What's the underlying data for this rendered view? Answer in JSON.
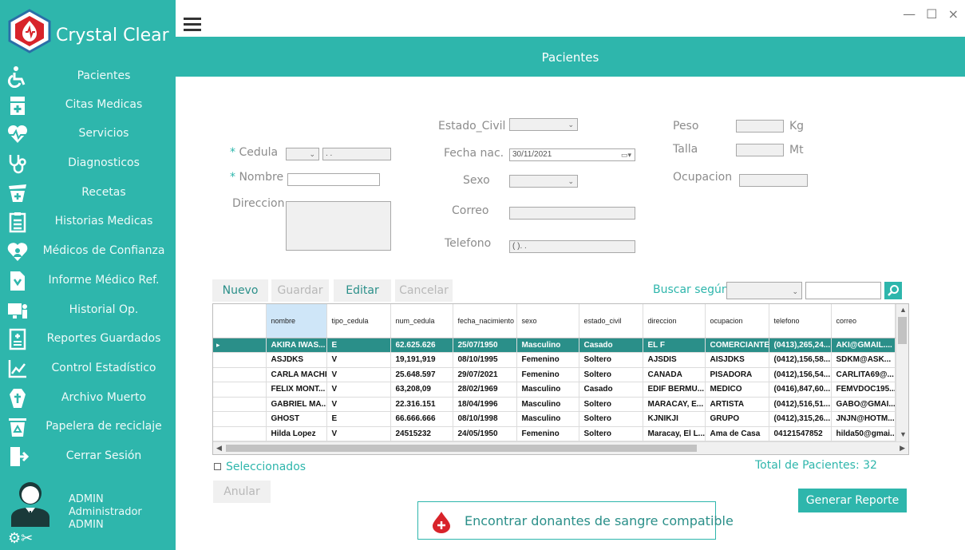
{
  "app": {
    "name": "Crystal Clear"
  },
  "window_controls": "— ☐ ×",
  "header": {
    "title": "Pacientes"
  },
  "sidebar": {
    "items": [
      {
        "label": "Pacientes",
        "icon": "wheelchair-icon"
      },
      {
        "label": "Citas Medicas",
        "icon": "calendar-icon"
      },
      {
        "label": "Servicios",
        "icon": "heartbeat-icon"
      },
      {
        "label": "Diagnosticos",
        "icon": "stethoscope-icon"
      },
      {
        "label": "Recetas",
        "icon": "medicine-bottle-icon"
      },
      {
        "label": "Historias Medicas",
        "icon": "clipboard-icon"
      },
      {
        "label": "Médicos de Confianza",
        "icon": "heart-user-icon"
      },
      {
        "label": "Informe Médico Ref.",
        "icon": "report-icon"
      },
      {
        "label": "Historial Op.",
        "icon": "monitor-user-icon"
      },
      {
        "label": "Reportes Guardados",
        "icon": "saved-document-icon"
      },
      {
        "label": "Control Estadístico",
        "icon": "chart-icon"
      },
      {
        "label": "Archivo Muerto",
        "icon": "coffin-icon"
      },
      {
        "label": "Papelera de reciclaje",
        "icon": "recycle-bin-icon"
      },
      {
        "label": "Cerrar Sesión",
        "icon": "logout-icon"
      }
    ],
    "user": {
      "line1": "ADMIN",
      "line2": "Administrador",
      "line3": "ADMIN"
    }
  },
  "form": {
    "cedula_label": "Cedula",
    "cedula_value": ". .",
    "nombre_label": "Nombre",
    "direccion_label": "Direccion",
    "estado_civil_label": "Estado_Civil",
    "fecha_nac_label": "Fecha nac.",
    "fecha_nac_value": "30/11/2021",
    "sexo_label": "Sexo",
    "correo_label": "Correo",
    "telefono_label": "Telefono",
    "telefono_value": "(  ).  .",
    "peso_label": "Peso",
    "peso_unit": "Kg",
    "talla_label": "Talla",
    "talla_unit": "Mt",
    "ocupacion_label": "Ocupacion",
    "required_mark": "*"
  },
  "toolbar": {
    "nuevo": "Nuevo",
    "guardar": "Guardar",
    "editar": "Editar",
    "cancelar": "Cancelar",
    "buscar_label": "Buscar según:"
  },
  "table": {
    "columns": [
      "nombre",
      "tipo_cedula",
      "num_cedula",
      "fecha_nacimiento",
      "sexo",
      "estado_civil",
      "direccion",
      "ocupacion",
      "telefono",
      "correo"
    ],
    "rows": [
      [
        "AKIRA IWAS...",
        "E",
        "62.625.626",
        "25/07/1950",
        "Masculino",
        "Casado",
        "EL F",
        "COMERCIANTE",
        "(0413),265,24...",
        "AKI@GMAIL...."
      ],
      [
        "ASJDKS",
        "V",
        "19,191,919",
        "08/10/1995",
        "Femenino",
        "Soltero",
        "AJSDIS",
        "AISJDKS",
        "(0412),156,58...",
        "SDKM@ASK..."
      ],
      [
        "CARLA MACHIN",
        "V",
        "25.648.597",
        "29/07/2021",
        "Femenino",
        "Soltero",
        "CANADA",
        "PISADORA",
        "(0412),156,54...",
        "CARLITA69@..."
      ],
      [
        "FELIX MONT...",
        "V",
        "63,208,09",
        "28/02/1969",
        "Masculino",
        "Casado",
        "EDIF BERMU...",
        "MEDICO",
        "(0416),847,60...",
        "FEMVDOC195..."
      ],
      [
        "GABRIEL MA...",
        "V",
        "22.316.151",
        "18/04/1996",
        "Masculino",
        "Soltero",
        "MARACAY, E...",
        "ARTISTA",
        "(0412),516,51...",
        "GABO@GMAI..."
      ],
      [
        "GHOST",
        "E",
        "66.666.666",
        "08/10/1998",
        "Masculino",
        "Soltero",
        "KJNIKJI",
        "GRUPO",
        "(0412),315,26...",
        "JNJN@HOTM..."
      ],
      [
        "Hilda Lopez",
        "V",
        "24515232",
        "24/05/1950",
        "Femenino",
        "Soltero",
        "Maracay, El L...",
        "Ama de Casa",
        "04121547852",
        "hilda50@gmai..."
      ]
    ],
    "active_row_marker": "▸"
  },
  "footer": {
    "seleccionados": "Seleccionados",
    "total": "Total de Pacientes: 32",
    "anular": "Anular",
    "generar": "Generar Reporte",
    "donantes": "Encontrar donantes de sangre compatible"
  },
  "colors": {
    "accent": "#2eb6ac",
    "active_row": "#2a8f89",
    "logo_red": "#d8232a"
  }
}
